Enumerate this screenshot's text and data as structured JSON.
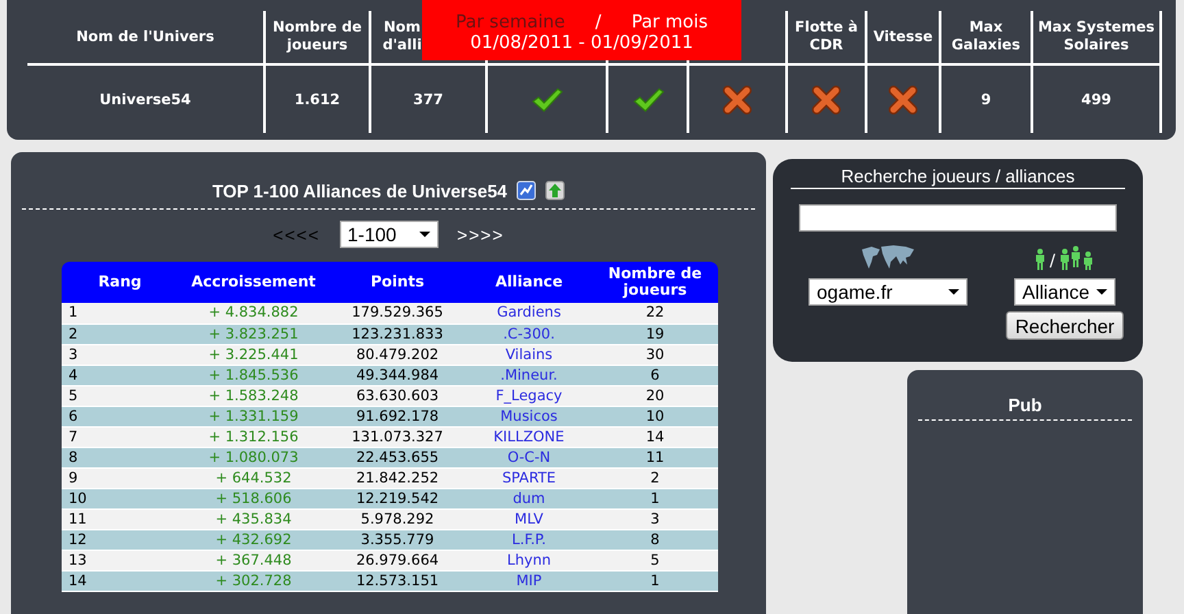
{
  "universe_table": {
    "columns": [
      {
        "header": "Nom de l'Univers"
      },
      {
        "header": "Nombre de joueurs"
      },
      {
        "header": "Nom d'alli"
      },
      {},
      {},
      {},
      {
        "header": "Flotte à CDR"
      },
      {
        "header": "Vitesse"
      },
      {
        "header": "Max Galaxies"
      },
      {
        "header": "Max Systemes Solaires"
      }
    ],
    "cells": [
      {
        "kind": "text",
        "text": "Universe54"
      },
      {
        "kind": "text",
        "text": "1.612"
      },
      {
        "kind": "text",
        "text": "377"
      },
      {
        "kind": "check"
      },
      {
        "kind": "check"
      },
      {
        "kind": "cross"
      },
      {
        "kind": "cross"
      },
      {
        "kind": "cross"
      },
      {
        "kind": "text",
        "text": "9"
      },
      {
        "kind": "text",
        "text": "499"
      }
    ]
  },
  "period_overlay": {
    "periods": [
      {
        "label": "Par semaine",
        "selected": true
      },
      {
        "label": "Par mois",
        "selected": false
      }
    ],
    "separator": "/",
    "date_range": "01/08/2011 - 01/09/2011"
  },
  "ranking": {
    "title": "TOP 1-100 Alliances de Universe54",
    "pager": {
      "prev": {
        "label": "<<<<",
        "disabled": true
      },
      "range": "1-100",
      "next": {
        "label": ">>>>",
        "disabled": false
      }
    },
    "columns": [
      "Rang",
      "Accroissement",
      "Points",
      "Alliance",
      "Nombre de joueurs"
    ],
    "rows": [
      {
        "rank": "1",
        "growth": "+ 4.834.882",
        "points": "179.529.365",
        "alliance": "Gardiens",
        "players": "22"
      },
      {
        "rank": "2",
        "growth": "+ 3.823.251",
        "points": "123.231.833",
        "alliance": ".C-300.",
        "players": "19"
      },
      {
        "rank": "3",
        "growth": "+ 3.225.441",
        "points": "80.479.202",
        "alliance": "Vilains",
        "players": "30"
      },
      {
        "rank": "4",
        "growth": "+ 1.845.536",
        "points": "49.344.984",
        "alliance": ".Mineur.",
        "players": "6"
      },
      {
        "rank": "5",
        "growth": "+ 1.583.248",
        "points": "63.630.603",
        "alliance": "F_Legacy",
        "players": "20"
      },
      {
        "rank": "6",
        "growth": "+ 1.331.159",
        "points": "91.692.178",
        "alliance": "Musicos",
        "players": "10"
      },
      {
        "rank": "7",
        "growth": "+ 1.312.156",
        "points": "131.073.327",
        "alliance": "KILLZONE",
        "players": "14"
      },
      {
        "rank": "8",
        "growth": "+ 1.080.073",
        "points": "22.453.655",
        "alliance": "O-C-N",
        "players": "11"
      },
      {
        "rank": "9",
        "growth": "+ 644.532",
        "points": "21.842.252",
        "alliance": "SPARTE",
        "players": "2"
      },
      {
        "rank": "10",
        "growth": "+ 518.606",
        "points": "12.219.542",
        "alliance": "dum",
        "players": "1"
      },
      {
        "rank": "11",
        "growth": "+ 435.834",
        "points": "5.978.292",
        "alliance": "MLV",
        "players": "3"
      },
      {
        "rank": "12",
        "growth": "+ 432.692",
        "points": "3.355.779",
        "alliance": "L.F.P.",
        "players": "8"
      },
      {
        "rank": "13",
        "growth": "+ 367.448",
        "points": "26.979.664",
        "alliance": "Lhynn",
        "players": "5"
      },
      {
        "rank": "14",
        "growth": "+ 302.728",
        "points": "12.573.151",
        "alliance": "MIP",
        "players": "1"
      }
    ]
  },
  "search": {
    "title": "Recherche joueurs / alliances",
    "server": "ogame.fr",
    "type_separator": "/",
    "type": "Alliance",
    "button": "Rechercher"
  },
  "pub": {
    "title": "Pub"
  }
}
